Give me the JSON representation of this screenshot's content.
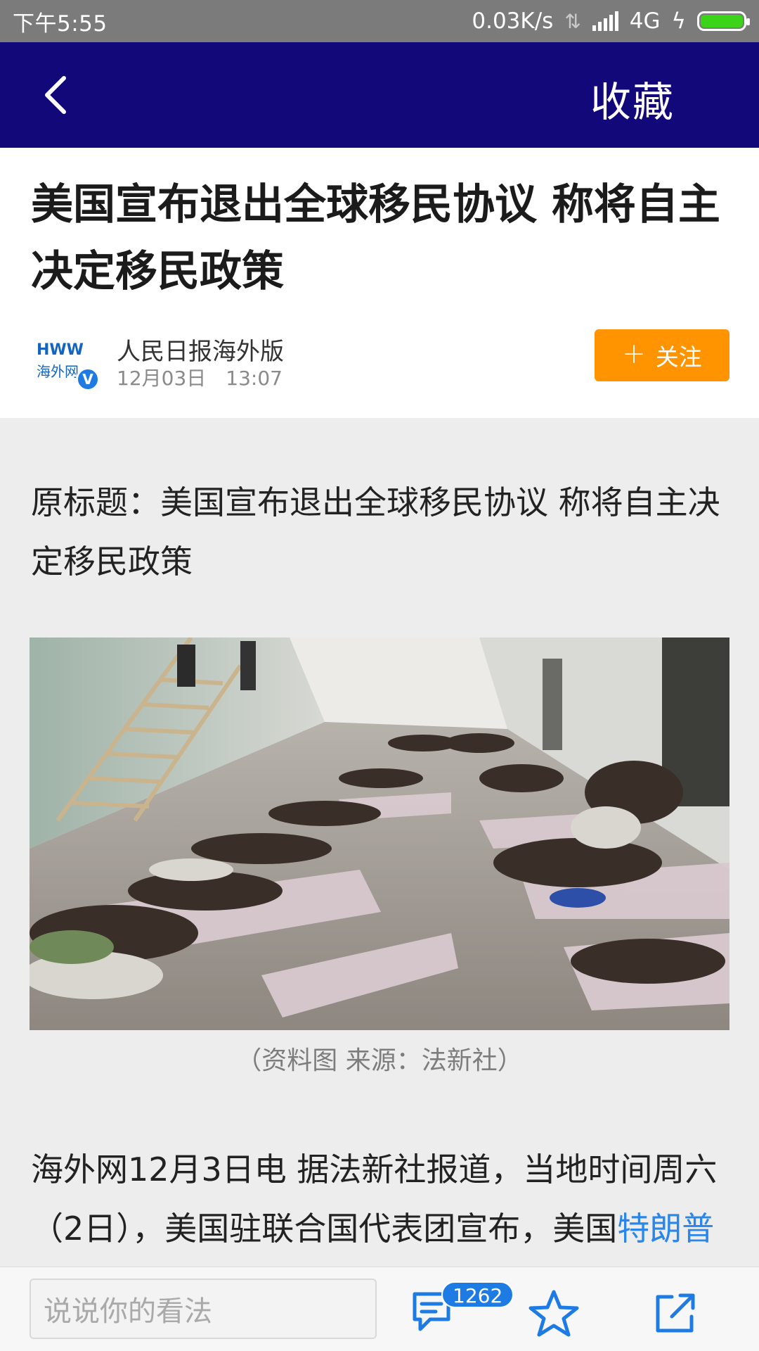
{
  "status_bar": {
    "time": "下午5:55",
    "net_speed": "0.03K/s",
    "network_type": "4G",
    "battery_color": "#3bd419"
  },
  "nav": {
    "back_icon": "chevron-left-icon",
    "favorite_label": "收藏",
    "bg_color": "#12087a"
  },
  "article": {
    "title": "美国宣布退出全球移民协议 称将自主决定移民政策",
    "author": {
      "name": "人民日报海外版",
      "avatar_text_top": "HWW",
      "avatar_text_bottom": "海外网",
      "verified_mark": "V"
    },
    "time": "12月03日　13:07",
    "follow_label": "关注",
    "follow_color": "#ff9400",
    "original_title": "原标题：美国宣布退出全球移民协议 称将自主决定移民政策",
    "image_caption": "（资料图 来源：法新社）",
    "body_text": "海外网12月3日电 据法新社报道，当地时间周六（2日），美国驻联合国代表团宣布，美国",
    "body_link": "特朗普"
  },
  "bottom_bar": {
    "comment_placeholder": "说说你的看法",
    "comment_count": "1262",
    "comment_icon": "comment-icon",
    "favorite_icon": "star-icon",
    "share_icon": "share-icon"
  }
}
